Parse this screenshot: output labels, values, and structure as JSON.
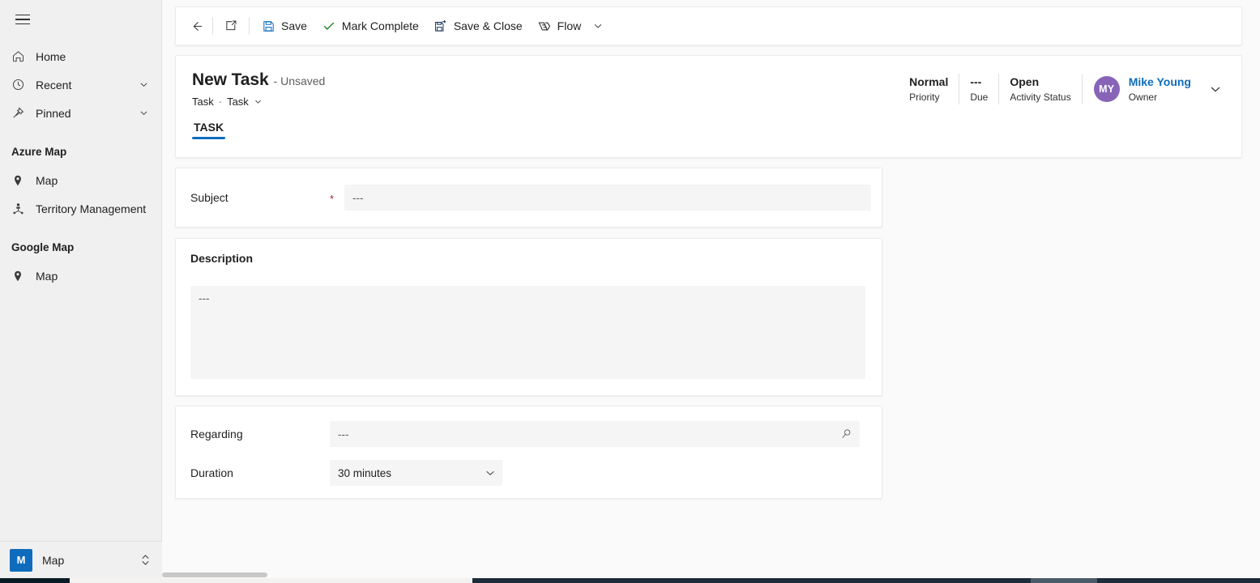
{
  "sidebar": {
    "menu_icon": "hamburger-icon",
    "items": [
      {
        "label": "Home",
        "icon": "home-icon",
        "chevron": false
      },
      {
        "label": "Recent",
        "icon": "clock-icon",
        "chevron": true
      },
      {
        "label": "Pinned",
        "icon": "pin-icon",
        "chevron": true
      }
    ],
    "groups": [
      {
        "title": "Azure Map",
        "items": [
          {
            "label": "Map",
            "icon": "map-pin-icon"
          },
          {
            "label": "Territory Management",
            "icon": "territory-icon"
          }
        ]
      },
      {
        "title": "Google Map",
        "items": [
          {
            "label": "Map",
            "icon": "map-pin-icon"
          }
        ]
      }
    ],
    "app_switcher": {
      "initial": "M",
      "name": "Map",
      "chevron_icon": "chevron-up-down-icon",
      "tile_color": "#0f6cbd"
    }
  },
  "command_bar": {
    "back_icon": "back-arrow-icon",
    "popout_icon": "open-in-new-window-icon",
    "buttons": [
      {
        "label": "Save",
        "icon": "save-floppy-icon"
      },
      {
        "label": "Mark Complete",
        "icon": "checkmark-icon"
      },
      {
        "label": "Save & Close",
        "icon": "save-and-close-icon"
      },
      {
        "label": "Flow",
        "icon": "flow-icon"
      }
    ],
    "overflow_icon": "chevron-down-icon"
  },
  "header": {
    "title": "New Task",
    "unsaved_label": "- Unsaved",
    "breadcrumb": {
      "entity": "Task",
      "separator": "·",
      "form": "Task",
      "chevron_icon": "chevron-down-icon"
    },
    "tabs": [
      {
        "label": "TASK",
        "active": true
      }
    ],
    "status": [
      {
        "value": "Normal",
        "label": "Priority"
      },
      {
        "value": "---",
        "label": "Due"
      },
      {
        "value": "Open",
        "label": "Activity Status"
      }
    ],
    "owner": {
      "initials": "MY",
      "name": "Mike Young",
      "role": "Owner",
      "avatar_color": "#8764b8",
      "name_color": "#0f6cbd",
      "chevron_icon": "chevron-down-icon"
    }
  },
  "form": {
    "subject": {
      "label": "Subject",
      "required_marker": "*",
      "value": "---"
    },
    "description": {
      "section_title": "Description",
      "value": "---"
    },
    "regarding": {
      "label": "Regarding",
      "value": "---",
      "lookup_icon": "search-icon"
    },
    "duration": {
      "label": "Duration",
      "value": "30 minutes",
      "chevron_icon": "chevron-down-icon"
    }
  },
  "theme": {
    "accent": "#0f6cbd",
    "required_red": "#a4262c",
    "page_bg": "#fafafa",
    "sidebar_bg": "#f0f0f0",
    "field_bg": "#f5f5f5"
  }
}
